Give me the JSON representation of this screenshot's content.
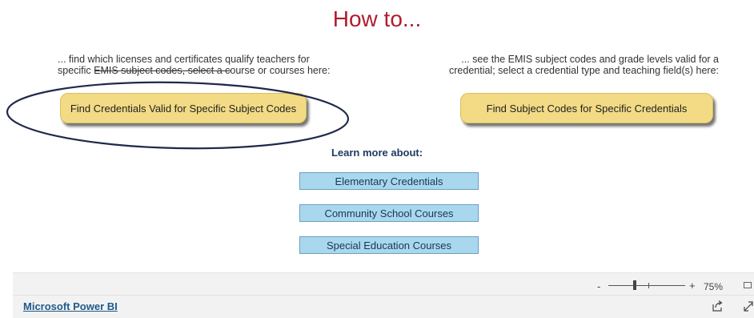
{
  "title": "How to...",
  "left_section": {
    "description_line1": "... find which licenses and certificates qualify teachers for",
    "description_line2": "specific EMIS subject codes, select a course or courses here:",
    "button_label": "Find Credentials Valid for Specific Subject Codes"
  },
  "right_section": {
    "description_line1": "... see the EMIS subject codes and grade levels valid for a",
    "description_line2": "credential; select a credential type and teaching field(s) here:",
    "button_label": "Find Subject Codes for Specific Credentials"
  },
  "learn_more": {
    "heading": "Learn more about:",
    "items": [
      {
        "label": "Elementary Credentials"
      },
      {
        "label": "Community School Courses"
      },
      {
        "label": "Special Education Courses"
      }
    ]
  },
  "footer": {
    "zoom_minus": "-",
    "zoom_plus": "+",
    "zoom_level": "75%",
    "zoom_fraction": 0.34,
    "link_label": "Microsoft Power BI"
  },
  "colors": {
    "title": "#b01c2e",
    "gold_button": "#f3db85",
    "blue_button": "#a9d8ee",
    "ellipse": "#1f2a4a"
  }
}
